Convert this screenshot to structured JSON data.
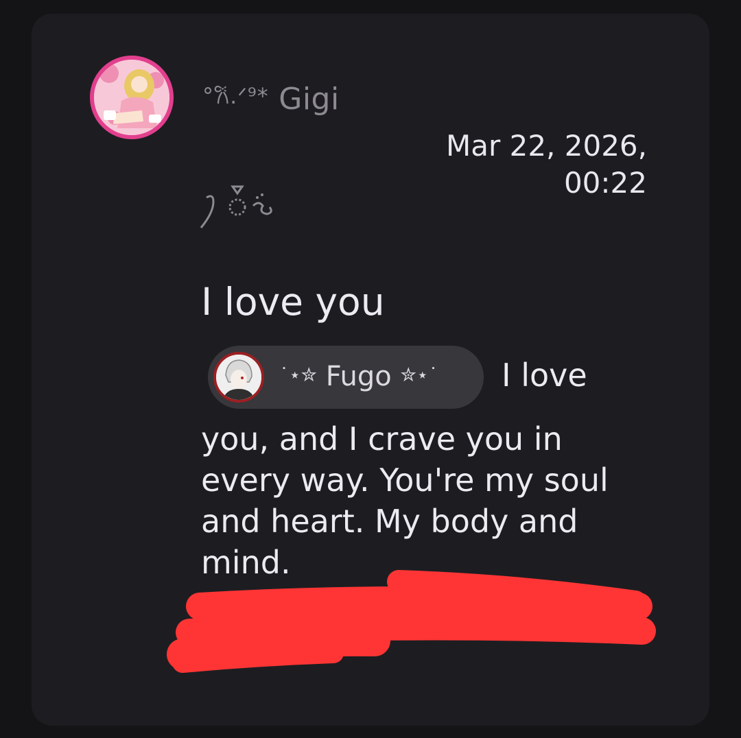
{
  "post": {
    "author": {
      "name": "Gigi",
      "name_prefix_deco": "°𐙚.ᐟ⁹*",
      "name_suffix_deco": "໑ 💍༄",
      "avatar": "user-avatar"
    },
    "timestamp": {
      "date": "Mar 22, 2026,",
      "time": "00:22"
    },
    "title": "I love you",
    "mention": {
      "name": "Fugo",
      "left_deco": "˙⋆✮",
      "right_deco": "✮⋆˙",
      "avatar": "mention-avatar"
    },
    "inline_text": "I love",
    "body": "you, and I crave you in every way. You're my soul and heart. My body and mind.",
    "redaction": {
      "color": "#ff3535"
    }
  },
  "colors": {
    "background": "#141417",
    "card": "#1d1d21",
    "mention_chip": "#37373c",
    "avatar_ring": "#e23f8e",
    "mention_ring": "#9b1f22"
  }
}
